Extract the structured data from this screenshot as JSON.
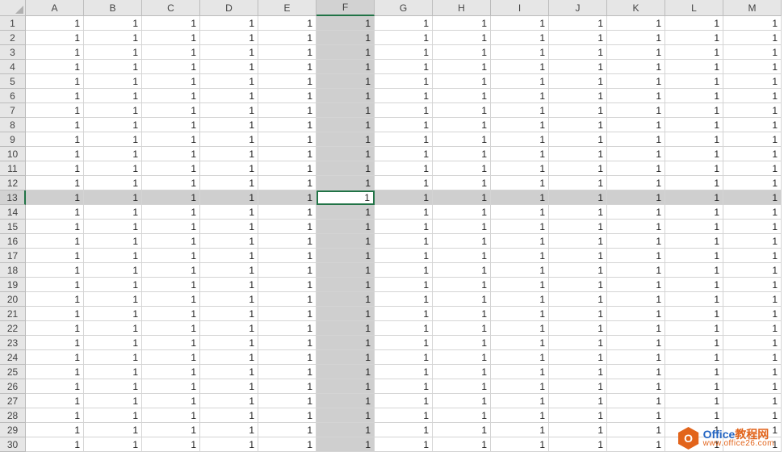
{
  "columns": [
    "A",
    "B",
    "C",
    "D",
    "E",
    "F",
    "G",
    "H",
    "I",
    "J",
    "K",
    "L",
    "M"
  ],
  "rowCount": 30,
  "highlightCol": "F",
  "highlightRow": 13,
  "activeCell": {
    "col": "F",
    "row": 13
  },
  "cellValue": "1",
  "watermark": {
    "iconLetter": "O",
    "titlePart1": "Office",
    "titlePart2": "教程网",
    "url": "www.office26.com"
  }
}
